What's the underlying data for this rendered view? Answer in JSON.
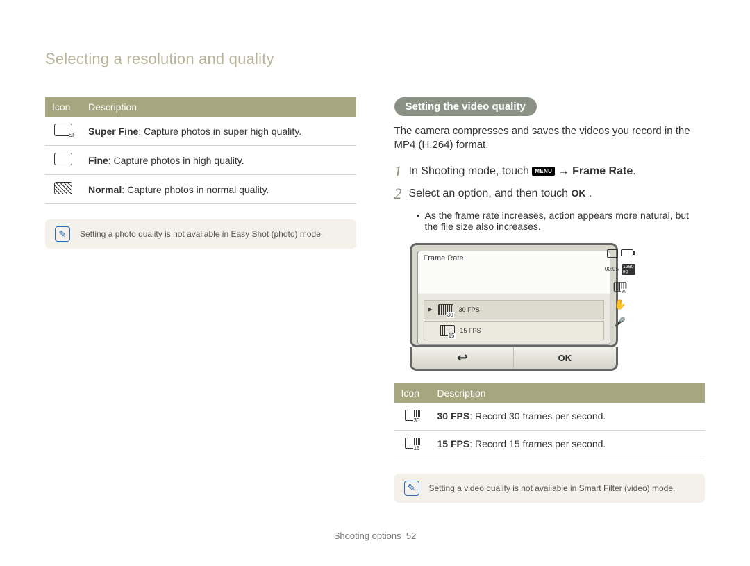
{
  "page": {
    "title": "Selecting a resolution and quality",
    "footer_label": "Shooting options",
    "footer_page": "52"
  },
  "left": {
    "table_headers": {
      "icon": "Icon",
      "desc": "Description"
    },
    "rows": [
      {
        "icon": "sf",
        "bold": "Super Fine",
        "rest": ": Capture photos in super high quality."
      },
      {
        "icon": "fine",
        "bold": "Fine",
        "rest": ": Capture photos in high quality."
      },
      {
        "icon": "normal",
        "bold": "Normal",
        "rest": ": Capture photos in normal quality."
      }
    ],
    "note": "Setting a photo quality is not available in Easy Shot (photo) mode."
  },
  "right": {
    "pill": "Setting the video quality",
    "intro": "The camera compresses and saves the videos you record in the MP4 (H.264) format.",
    "steps": [
      {
        "num": "1",
        "pre": "In Shooting mode, touch ",
        "menu": "MENU",
        "mid": " → ",
        "bold_after": "Frame Rate",
        "post": "."
      },
      {
        "num": "2",
        "pre": "Select an option, and then touch ",
        "ok": "OK",
        "post": " ."
      }
    ],
    "bullet": "As the frame rate increases, action appears more natural, but the file size also increases.",
    "cam": {
      "title": "Frame Rate",
      "time": "00:05",
      "res": "1280",
      "res_sub": "HQ",
      "items": [
        {
          "label": "30 FPS",
          "icon": "f30",
          "selected": true
        },
        {
          "label": "15 FPS",
          "icon": "f15",
          "selected": false
        }
      ],
      "back": "↩",
      "ok": "OK"
    },
    "fps_table_headers": {
      "icon": "Icon",
      "desc": "Description"
    },
    "fps_rows": [
      {
        "icon": "f30",
        "bold": "30 FPS",
        "rest": ": Record 30 frames per second."
      },
      {
        "icon": "f15",
        "bold": "15 FPS",
        "rest": ": Record 15 frames per second."
      }
    ],
    "note": "Setting a video quality is not available in Smart Filter (video) mode."
  }
}
